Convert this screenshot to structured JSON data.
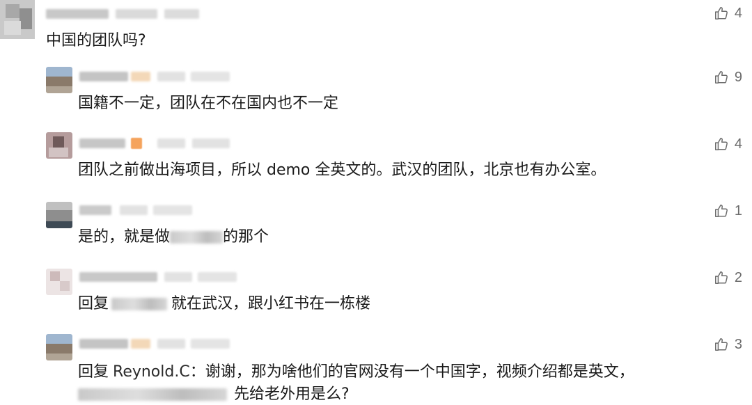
{
  "comments": [
    {
      "id": "top",
      "text": "中国的团队吗?",
      "likes": "4"
    },
    {
      "id": "r1",
      "text": "国籍不一定，团队在不在国内也不一定",
      "likes": "9"
    },
    {
      "id": "r2",
      "text": "团队之前做出海项目，所以 demo 全英文的。武汉的团队，北京也有办公室。",
      "likes": "4"
    },
    {
      "id": "r3",
      "text_before": "是的，就是做",
      "text_after": "的那个",
      "likes": "1"
    },
    {
      "id": "r4",
      "reply_prefix": "回复",
      "text_after": "就在武汉，跟小红书在一栋楼",
      "likes": "2"
    },
    {
      "id": "r5",
      "reply_prefix": "回复",
      "reply_target": "Reynold.C",
      "text_line1": "：谢谢，那为啥他们的官网没有一个中国字，视频介绍都是英文，",
      "text_line2_after": "先给老外用是么?",
      "likes": "3"
    }
  ],
  "icons": {
    "like": "thumbs-up-icon"
  },
  "colors": {
    "text": "#1a1a1a",
    "meta": "#6b6b6b",
    "blur_gray": "#d0d0d0",
    "badge_orange": "#f5a35c"
  }
}
